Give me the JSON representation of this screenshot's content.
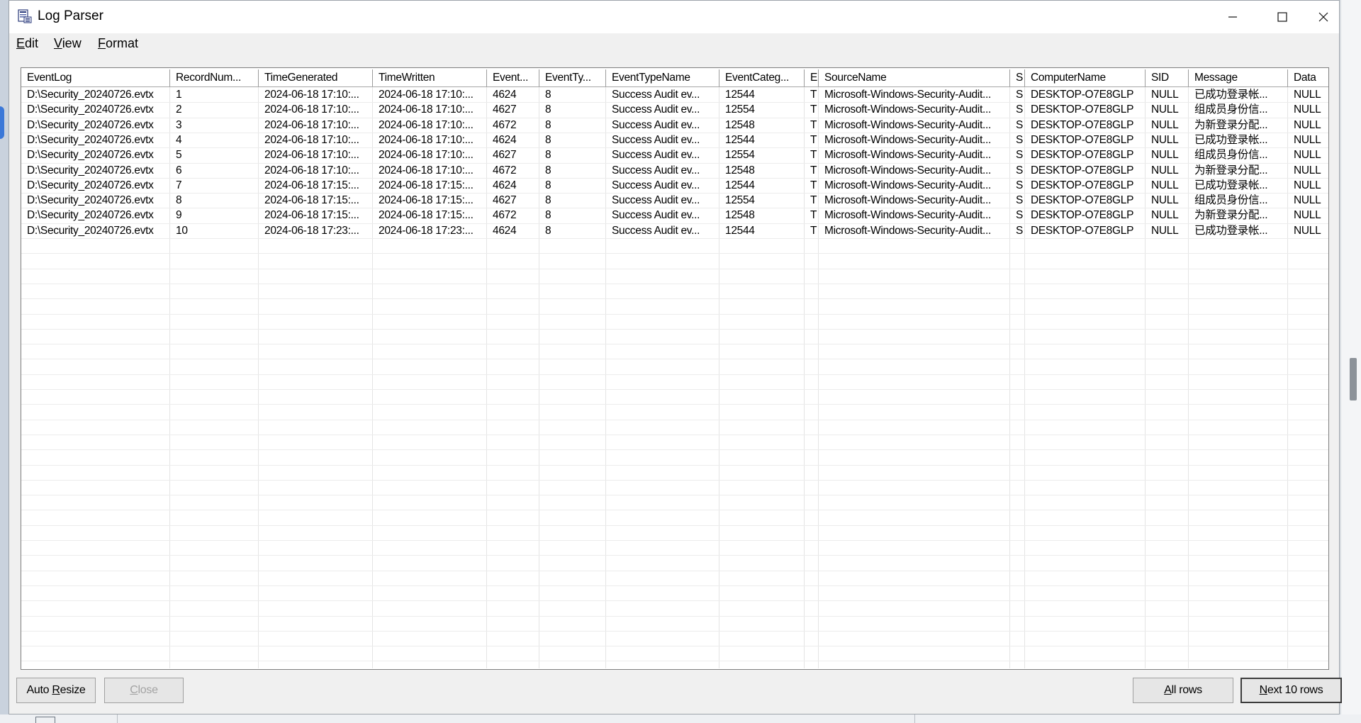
{
  "window": {
    "title": "Log Parser"
  },
  "menu": [
    {
      "label": "Edit",
      "key": "E",
      "rest": "dit"
    },
    {
      "label": "View",
      "key": "V",
      "rest": "iew"
    },
    {
      "label": "Format",
      "key": "F",
      "rest": "ormat"
    }
  ],
  "table": {
    "headers": [
      "EventLog",
      "RecordNum...",
      "TimeGenerated",
      "TimeWritten",
      "Event...",
      "EventTy...",
      "EventTypeName",
      "EventCateg...",
      "E",
      "SourceName",
      "S",
      "ComputerName",
      "SID",
      "Message",
      "Data"
    ],
    "rows": [
      [
        "D:\\Security_20240726.evtx",
        "1",
        "2024-06-18 17:10:...",
        "2024-06-18 17:10:...",
        "4624",
        "8",
        "Success Audit ev...",
        "12544",
        "T",
        "Microsoft-Windows-Security-Audit...",
        "S",
        "DESKTOP-O7E8GLP",
        "NULL",
        "已成功登录帐...",
        "NULL"
      ],
      [
        "D:\\Security_20240726.evtx",
        "2",
        "2024-06-18 17:10:...",
        "2024-06-18 17:10:...",
        "4627",
        "8",
        "Success Audit ev...",
        "12554",
        "T",
        "Microsoft-Windows-Security-Audit...",
        "S",
        "DESKTOP-O7E8GLP",
        "NULL",
        "组成员身份信...",
        "NULL"
      ],
      [
        "D:\\Security_20240726.evtx",
        "3",
        "2024-06-18 17:10:...",
        "2024-06-18 17:10:...",
        "4672",
        "8",
        "Success Audit ev...",
        "12548",
        "T",
        "Microsoft-Windows-Security-Audit...",
        "S",
        "DESKTOP-O7E8GLP",
        "NULL",
        "为新登录分配...",
        "NULL"
      ],
      [
        "D:\\Security_20240726.evtx",
        "4",
        "2024-06-18 17:10:...",
        "2024-06-18 17:10:...",
        "4624",
        "8",
        "Success Audit ev...",
        "12544",
        "T",
        "Microsoft-Windows-Security-Audit...",
        "S",
        "DESKTOP-O7E8GLP",
        "NULL",
        "已成功登录帐...",
        "NULL"
      ],
      [
        "D:\\Security_20240726.evtx",
        "5",
        "2024-06-18 17:10:...",
        "2024-06-18 17:10:...",
        "4627",
        "8",
        "Success Audit ev...",
        "12554",
        "T",
        "Microsoft-Windows-Security-Audit...",
        "S",
        "DESKTOP-O7E8GLP",
        "NULL",
        "组成员身份信...",
        "NULL"
      ],
      [
        "D:\\Security_20240726.evtx",
        "6",
        "2024-06-18 17:10:...",
        "2024-06-18 17:10:...",
        "4672",
        "8",
        "Success Audit ev...",
        "12548",
        "T",
        "Microsoft-Windows-Security-Audit...",
        "S",
        "DESKTOP-O7E8GLP",
        "NULL",
        "为新登录分配...",
        "NULL"
      ],
      [
        "D:\\Security_20240726.evtx",
        "7",
        "2024-06-18 17:15:...",
        "2024-06-18 17:15:...",
        "4624",
        "8",
        "Success Audit ev...",
        "12544",
        "T",
        "Microsoft-Windows-Security-Audit...",
        "S",
        "DESKTOP-O7E8GLP",
        "NULL",
        "已成功登录帐...",
        "NULL"
      ],
      [
        "D:\\Security_20240726.evtx",
        "8",
        "2024-06-18 17:15:...",
        "2024-06-18 17:15:...",
        "4627",
        "8",
        "Success Audit ev...",
        "12554",
        "T",
        "Microsoft-Windows-Security-Audit...",
        "S",
        "DESKTOP-O7E8GLP",
        "NULL",
        "组成员身份信...",
        "NULL"
      ],
      [
        "D:\\Security_20240726.evtx",
        "9",
        "2024-06-18 17:15:...",
        "2024-06-18 17:15:...",
        "4672",
        "8",
        "Success Audit ev...",
        "12548",
        "T",
        "Microsoft-Windows-Security-Audit...",
        "S",
        "DESKTOP-O7E8GLP",
        "NULL",
        "为新登录分配...",
        "NULL"
      ],
      [
        "D:\\Security_20240726.evtx",
        "10",
        "2024-06-18 17:23:...",
        "2024-06-18 17:23:...",
        "4624",
        "8",
        "Success Audit ev...",
        "12544",
        "T",
        "Microsoft-Windows-Security-Audit...",
        "S",
        "DESKTOP-O7E8GLP",
        "NULL",
        "已成功登录帐...",
        "NULL"
      ]
    ]
  },
  "buttons": {
    "auto_resize": {
      "label": "Auto Resize",
      "pre": "Auto ",
      "key": "R",
      "post": "esize"
    },
    "close": {
      "label": "Close",
      "pre": "",
      "key": "C",
      "post": "lose"
    },
    "all_rows": {
      "label": "All rows",
      "pre": "",
      "key": "A",
      "post": "ll rows"
    },
    "next_rows": {
      "label": "Next 10 rows",
      "pre": "",
      "key": "N",
      "post": "ext 10 rows"
    }
  }
}
